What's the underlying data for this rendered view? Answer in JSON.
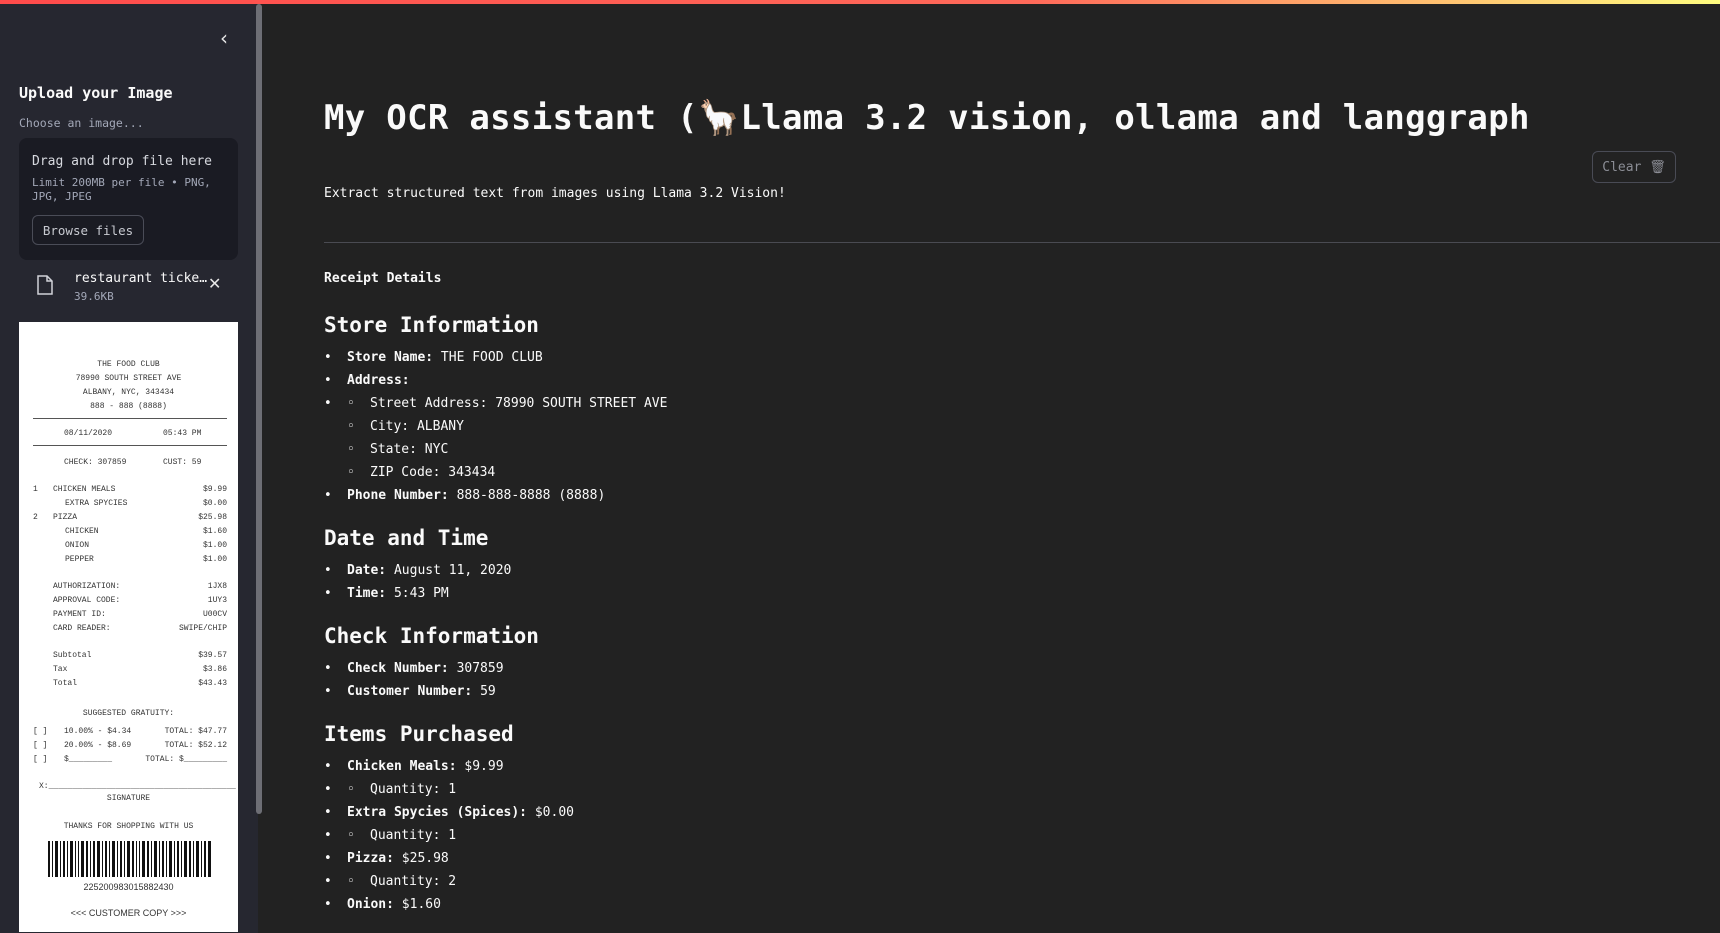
{
  "colors": {
    "background": "#222222",
    "sidebar": "#262730",
    "dropzone": "#1a1b23",
    "accent": "#ff4b4b"
  },
  "sidebar": {
    "collapse_icon": "chevron-left-icon",
    "upload_title": "Upload your Image",
    "uploader_label": "Choose an image...",
    "dropzone_text": "Drag and drop file here",
    "dropzone_limit": "Limit 200MB per file • PNG, JPG, JPEG",
    "browse_label": "Browse files",
    "file": {
      "name": "restaurant ticke…",
      "size": "39.6KB",
      "icon": "file-icon",
      "close_icon": "close-icon"
    }
  },
  "receipt": {
    "store": "THE FOOD CLUB",
    "address1": "78990 SOUTH STREET AVE",
    "address2": "ALBANY, NYC, 343434",
    "phone": "888 - 888 (8888)",
    "date": "08/11/2020",
    "time": "05:43 PM",
    "check": "CHECK: 307859",
    "cust": "CUST: 59",
    "lines": [
      {
        "qty": "1",
        "name": "CHICKEN MEALS",
        "price": "$9.99",
        "sub": false
      },
      {
        "qty": "",
        "name": "EXTRA SPYCIES",
        "price": "$0.00",
        "sub": true
      },
      {
        "qty": "2",
        "name": "PIZZA",
        "price": "$25.98",
        "sub": false
      },
      {
        "qty": "",
        "name": "CHICKEN",
        "price": "$1.60",
        "sub": true
      },
      {
        "qty": "",
        "name": "ONION",
        "price": "$1.00",
        "sub": true
      },
      {
        "qty": "",
        "name": "PEPPER",
        "price": "$1.00",
        "sub": true
      }
    ],
    "auth": [
      {
        "k": "AUTHORIZATION:",
        "v": "1JX8"
      },
      {
        "k": "APPROVAL CODE:",
        "v": "1UY3"
      },
      {
        "k": "PAYMENT ID:",
        "v": "U00CV"
      },
      {
        "k": "CARD READER:",
        "v": "SWIPE/CHIP"
      }
    ],
    "totals": [
      {
        "k": "Subtotal",
        "v": "$39.57"
      },
      {
        "k": "Tax",
        "v": "$3.86"
      },
      {
        "k": "Total",
        "v": "$43.43"
      }
    ],
    "gratuity_title": "SUGGESTED GRATUITY:",
    "gratuity": [
      {
        "pct": "10.00% - $4.34",
        "total": "TOTAL:  $47.77"
      },
      {
        "pct": "20.00% - $8.69",
        "total": "TOTAL:  $52.12"
      },
      {
        "pct": "$_________",
        "total": "TOTAL:  $_________"
      }
    ],
    "checkbox": "[  ]",
    "signature_line": "X:_______________________________________",
    "signature": "SIGNATURE",
    "thanks": "THANKS FOR SHOPPING WITH US",
    "barcode_number": "225200983015882430",
    "footer": "<<<   CUSTOMER COPY   >>>"
  },
  "main": {
    "title": "My OCR assistant (🦙Llama 3.2 vision, ollama and langgraph",
    "clear_label": "Clear 🗑",
    "subtitle": "Extract structured text from images using Llama 3.2 Vision!",
    "section_label": "Receipt Details",
    "store_heading": "Store Information",
    "store_name_label": "Store Name:",
    "store_name": "THE FOOD CLUB",
    "address_label": "Address:",
    "street_label": "Street Address:",
    "street": "78990 SOUTH STREET AVE",
    "city_label": "City:",
    "city": "ALBANY",
    "state_label": "State:",
    "state": "NYC",
    "zip_label": "ZIP Code:",
    "zip": "343434",
    "phone_label": "Phone Number:",
    "phone": "888-888-8888 (8888)",
    "datetime_heading": "Date and Time",
    "date_label": "Date:",
    "date": "August 11, 2020",
    "time_label": "Time:",
    "time": "5:43 PM",
    "check_heading": "Check Information",
    "check_label": "Check Number:",
    "check": "307859",
    "customer_label": "Customer Number:",
    "customer": "59",
    "items_heading": "Items Purchased",
    "item1_label": "Chicken Meals:",
    "item1": "$9.99",
    "item1_qty": "Quantity: 1",
    "item2_label": "Extra Spycies (Spices):",
    "item2": "$0.00",
    "item2_qty": "Quantity: 1",
    "item3_label": "Pizza:",
    "item3": "$25.98",
    "item3_qty": "Quantity: 2",
    "item4_label": "Onion:",
    "item4": "$1.60"
  }
}
